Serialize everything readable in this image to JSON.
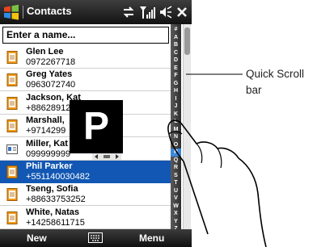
{
  "titlebar": {
    "title": "Contacts",
    "icons": [
      "start-icon",
      "sync-icon",
      "signal-icon",
      "speaker-icon",
      "close-icon"
    ]
  },
  "search": {
    "value": "Enter a name..."
  },
  "contacts": [
    {
      "name": "Glen Lee",
      "phone": "0972267718",
      "icon": "contact-card-icon",
      "selected": false
    },
    {
      "name": "Greg Yates",
      "phone": "0963072740",
      "icon": "contact-card-icon",
      "selected": false
    },
    {
      "name": "Jackson, Kat",
      "phone": "+88628912",
      "icon": "contact-card-icon",
      "selected": false
    },
    {
      "name": "Marshall, ",
      "phone": "+9714299",
      "icon": "contact-card-icon",
      "selected": false
    },
    {
      "name": "Miller, Kat",
      "phone": "099999999",
      "icon": "sim-contact-icon",
      "selected": false
    },
    {
      "name": "Phil Parker",
      "phone": "+551140030482",
      "icon": "contact-card-icon",
      "selected": true
    },
    {
      "name": "Tseng, Sofia",
      "phone": "+88633753252",
      "icon": "contact-card-icon",
      "selected": false
    },
    {
      "name": "White, Natas",
      "phone": "+14258611715",
      "icon": "contact-card-icon",
      "selected": false
    }
  ],
  "quick_scroll": {
    "letters": [
      "#",
      "A",
      "B",
      "C",
      "D",
      "E",
      "F",
      "G",
      "H",
      "I",
      "J",
      "K",
      "L",
      "M",
      "N",
      "O",
      "P",
      "Q",
      "R",
      "S",
      "T",
      "U",
      "V",
      "W",
      "X",
      "Y",
      "Z"
    ],
    "active": "P"
  },
  "letter_popup": "P",
  "softkeys": {
    "left": "New",
    "right": "Menu",
    "center_icon": "keyboard-icon"
  },
  "callout": {
    "label_line1": "Quick Scroll",
    "label_line2": "bar"
  },
  "colors": {
    "selection": "#1257b3",
    "titlebar": "#1a1a1a",
    "qs_active": "#3d88d8"
  }
}
